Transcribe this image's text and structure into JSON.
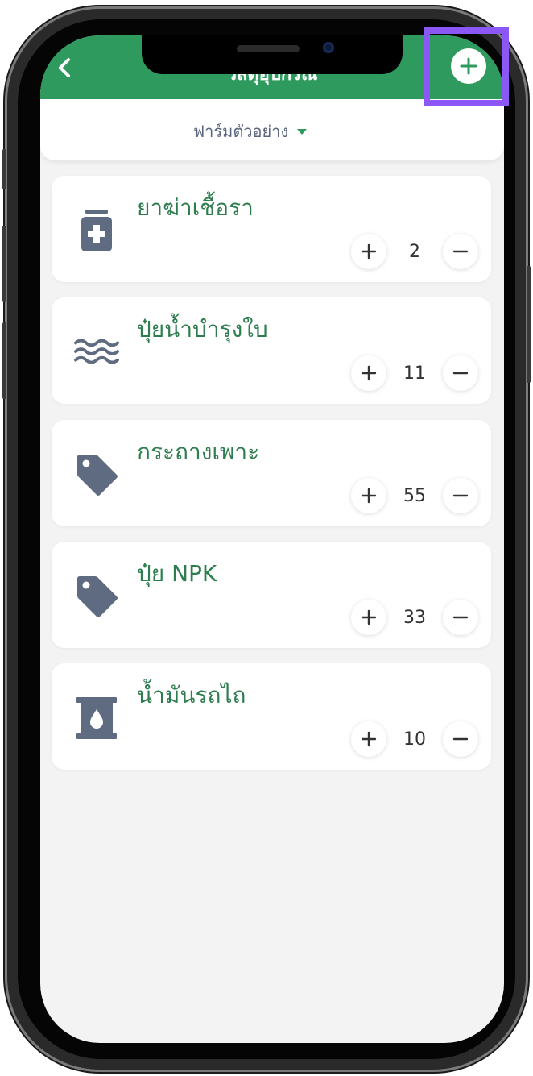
{
  "header": {
    "title": "วัสดุอุปกรณ์"
  },
  "farm_selector": {
    "selected": "ฟาร์มตัวอย่าง"
  },
  "items": [
    {
      "name": "ยาฆ่าเชื้อรา",
      "quantity": "2",
      "icon": "medicine-jar-icon"
    },
    {
      "name": "ปุ๋ยน้ำบำรุงใบ",
      "quantity": "11",
      "icon": "water-waves-icon"
    },
    {
      "name": "กระถางเพาะ",
      "quantity": "55",
      "icon": "tag-icon"
    },
    {
      "name": "ปุ๋ย NPK",
      "quantity": "33",
      "icon": "tag-icon"
    },
    {
      "name": "น้ำมันรถไถ",
      "quantity": "10",
      "icon": "oil-barrel-icon"
    }
  ],
  "colors": {
    "header_green": "#2e9a5e",
    "item_name_green": "#2e7d4f",
    "icon_slate": "#5e6b80",
    "highlight_purple": "#8b57f5"
  }
}
